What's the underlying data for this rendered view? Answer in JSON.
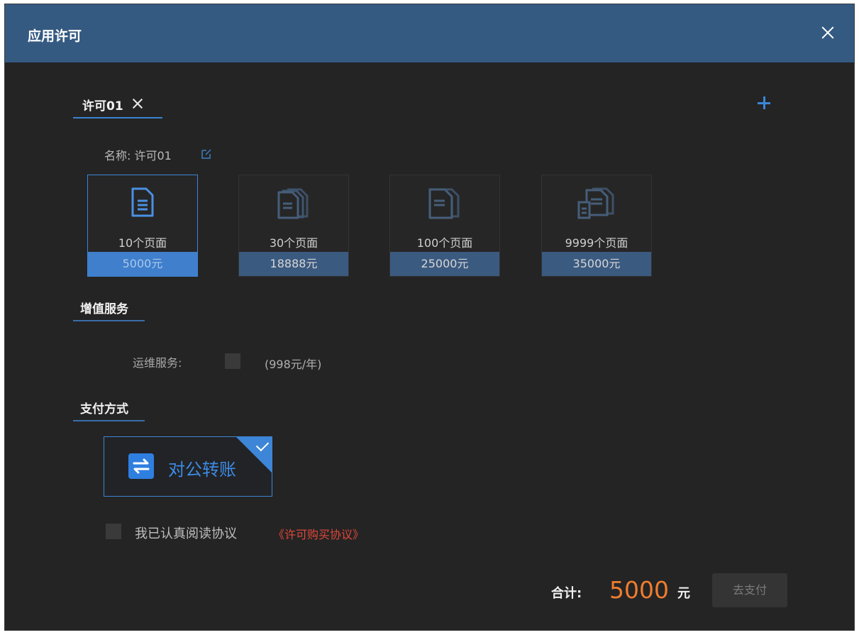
{
  "dialog": {
    "title": "应用许可"
  },
  "tabs": [
    {
      "label": "许可01"
    }
  ],
  "name_row": {
    "label": "名称:",
    "value": "许可01"
  },
  "packages": [
    {
      "label": "10个页面",
      "price": "5000元",
      "selected": true,
      "icon": "single-page-icon"
    },
    {
      "label": "30个页面",
      "price": "18888元",
      "selected": false,
      "icon": "multi-page-icon"
    },
    {
      "label": "100个页面",
      "price": "25000元",
      "selected": false,
      "icon": "multi-page-icon"
    },
    {
      "label": "9999个页面",
      "price": "35000元",
      "selected": false,
      "icon": "stacked-pages-icon"
    }
  ],
  "value_added": {
    "title": "增值服务",
    "ops_label": "运维服务:",
    "ops_price": "(998元/年)",
    "ops_checked": false
  },
  "payment": {
    "title": "支付方式",
    "method_label": "对公转账",
    "selected": true
  },
  "agreement": {
    "text": "我已认真阅读协议",
    "link": "《许可购买协议》",
    "checked": false
  },
  "footer": {
    "total_label": "合计:",
    "total_value": "5000",
    "unit": "元",
    "pay_button": "去支付"
  },
  "colors": {
    "header": "#355a82",
    "accent": "#3d85d6",
    "total": "#ef7d2e",
    "link": "#e0473a"
  }
}
